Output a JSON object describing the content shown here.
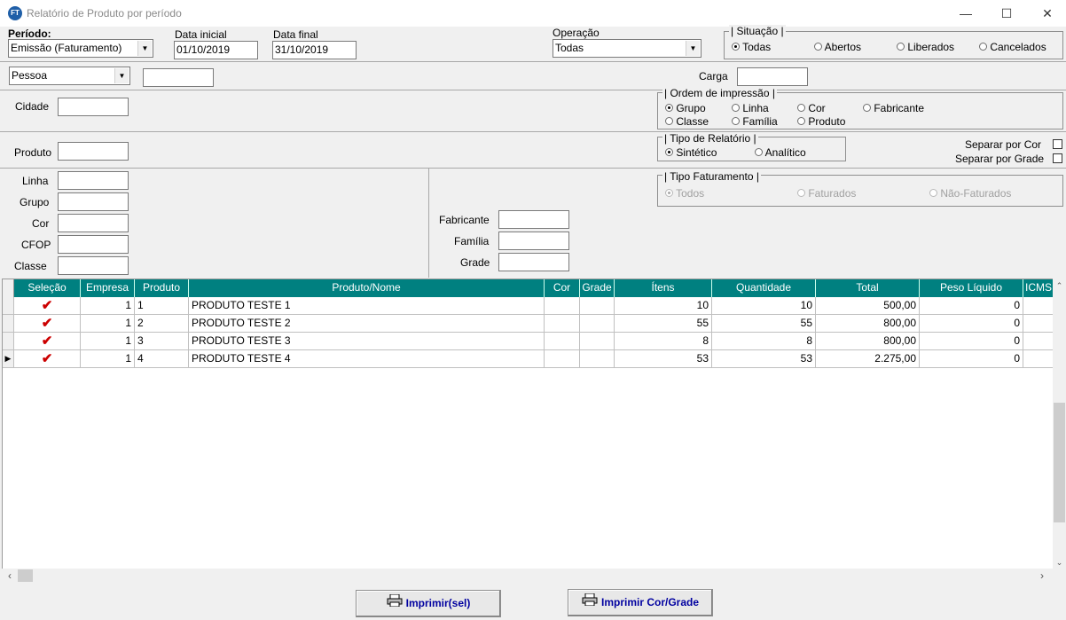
{
  "window": {
    "title": "Relatório de Produto por período",
    "icon_text": "FT",
    "minimize": "—",
    "maximize": "☐",
    "close": "✕"
  },
  "top": {
    "periodo_label": "Período:",
    "periodo_value": "Emissão (Faturamento)",
    "data_inicial_label": "Data inicial",
    "data_inicial_value": "01/10/2019",
    "data_final_label": "Data final",
    "data_final_value": "31/10/2019",
    "operacao_label": "Operação",
    "operacao_value": "Todas"
  },
  "situacao": {
    "title": "Situação",
    "options": [
      "Todas",
      "Abertos",
      "Liberados",
      "Cancelados"
    ],
    "selected": "Todas"
  },
  "pessoa": {
    "combo_value": "Pessoa",
    "field_value": ""
  },
  "carga": {
    "label": "Carga",
    "value": ""
  },
  "cidade": {
    "label": "Cidade",
    "value": ""
  },
  "ordem": {
    "title": "Ordem de impressão",
    "options": [
      "Grupo",
      "Linha",
      "Cor",
      "Fabricante",
      "Classe",
      "Família",
      "Produto"
    ],
    "selected": "Grupo"
  },
  "produto": {
    "label": "Produto",
    "value": ""
  },
  "tipo_relatorio": {
    "title": "Tipo de Relatório",
    "options": [
      "Sintético",
      "Analítico"
    ],
    "selected": "Sintético"
  },
  "separar": {
    "cor_label": "Separar por Cor",
    "grade_label": "Separar por Grade"
  },
  "filters_left": {
    "linha": "Linha",
    "grupo": "Grupo",
    "cor": "Cor",
    "cfop": "CFOP",
    "classe": "Classe"
  },
  "filters_mid": {
    "fabricante": "Fabricante",
    "familia": "Família",
    "grade": "Grade"
  },
  "tipo_faturamento": {
    "title": "Tipo Faturamento",
    "options": [
      "Todos",
      "Faturados",
      "Não-Faturados"
    ],
    "selected": "Todos"
  },
  "grid": {
    "columns": [
      "Seleção",
      "Empresa",
      "Produto",
      "Produto/Nome",
      "Cor",
      "Grade",
      "Ítens",
      "Quantidade",
      "Total",
      "Peso Líquido",
      "ICMS"
    ],
    "rows": [
      {
        "sel": "✔",
        "empresa": "1",
        "produto": "1",
        "nome": "PRODUTO TESTE 1",
        "cor": "",
        "grade": "",
        "itens": "10",
        "quantidade": "10",
        "total": "500,00",
        "peso": "0"
      },
      {
        "sel": "✔",
        "empresa": "1",
        "produto": "2",
        "nome": "PRODUTO TESTE 2",
        "cor": "",
        "grade": "",
        "itens": "55",
        "quantidade": "55",
        "total": "800,00",
        "peso": "0"
      },
      {
        "sel": "✔",
        "empresa": "1",
        "produto": "3",
        "nome": "PRODUTO TESTE 3",
        "cor": "",
        "grade": "",
        "itens": "8",
        "quantidade": "8",
        "total": "800,00",
        "peso": "0"
      },
      {
        "sel": "✔",
        "empresa": "1",
        "produto": "4",
        "nome": "PRODUTO TESTE 4",
        "cor": "",
        "grade": "",
        "itens": "53",
        "quantidade": "53",
        "total": "2.275,00",
        "peso": "0"
      }
    ],
    "current_row_marker": "▶"
  },
  "buttons": {
    "imprimir_sel": "Imprimir(sel)",
    "imprimir_cor_grade": "Imprimir Cor/Grade"
  },
  "colors": {
    "grid_header": "#008080",
    "check": "#cc0000",
    "button_text": "#0000a0"
  }
}
